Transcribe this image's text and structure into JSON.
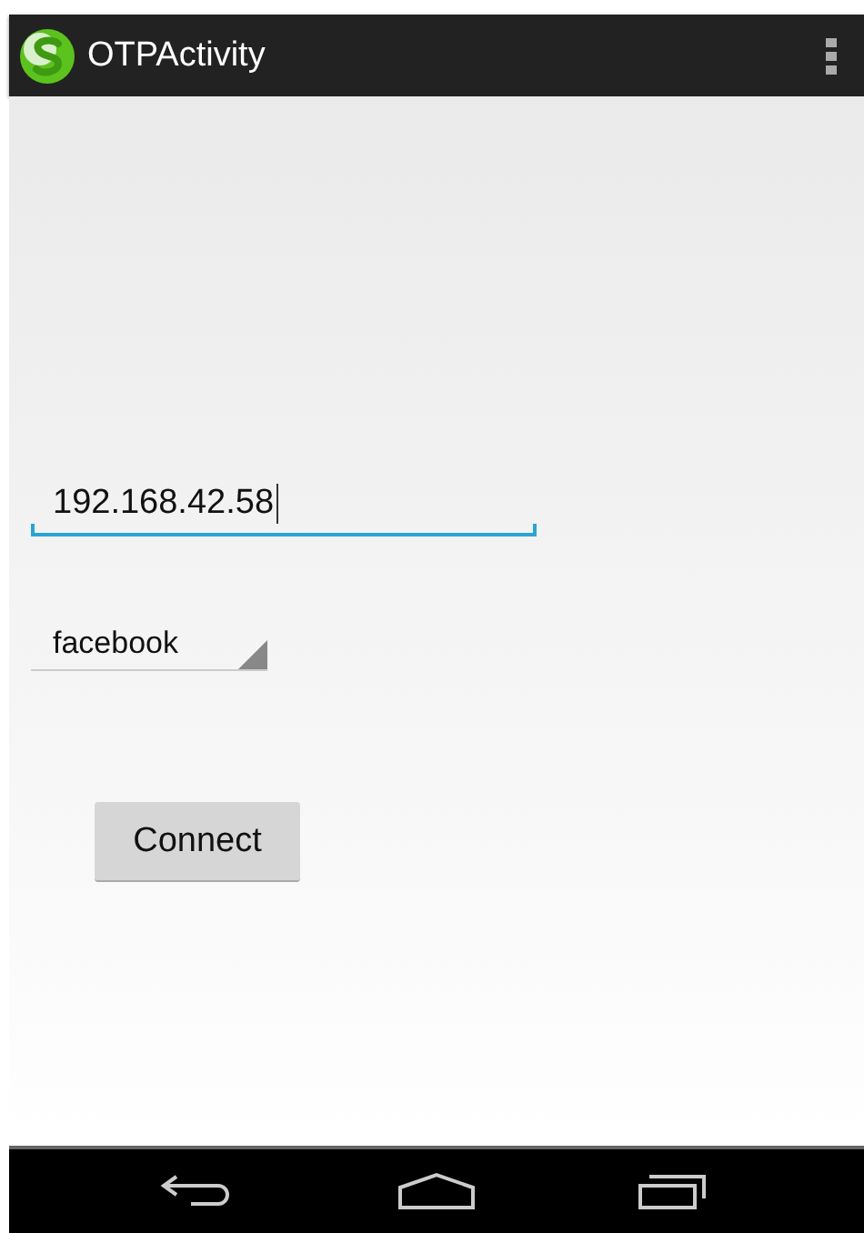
{
  "action_bar": {
    "title": "OTPActivity"
  },
  "ip_field": {
    "value": "192.168.42.58",
    "focused": true
  },
  "spinner": {
    "value": "facebook"
  },
  "connect_button": {
    "label": "Connect"
  }
}
